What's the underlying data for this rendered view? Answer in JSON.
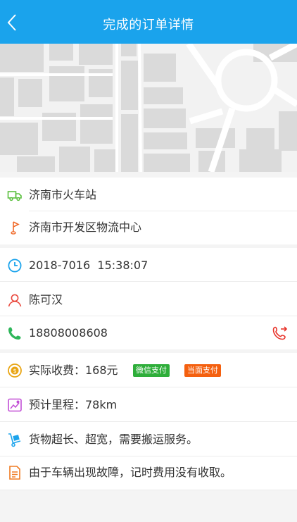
{
  "header": {
    "title": "完成的订单详情",
    "back_icon": "chevron-left-icon",
    "background_color": "#1aa3ec"
  },
  "route": {
    "origin": "济南市火车站",
    "destination": "济南市开发区物流中心",
    "origin_icon": "truck-icon",
    "destination_icon": "flag-pin-icon"
  },
  "order": {
    "datetime": "2018-7016  15:38:07",
    "customer_name": "陈可汉",
    "phone": "18808008608",
    "call_icon": "phone-call-icon"
  },
  "charges": {
    "fee": "实际收费：168元",
    "payment_wechat": "微信支付",
    "payment_cash": "当面支付",
    "distance": "预计里程：78km",
    "cargo_note": "货物超长、超宽，需要搬运服务。",
    "remark": "由于车辆出现故障，记时费用没有收取。"
  }
}
